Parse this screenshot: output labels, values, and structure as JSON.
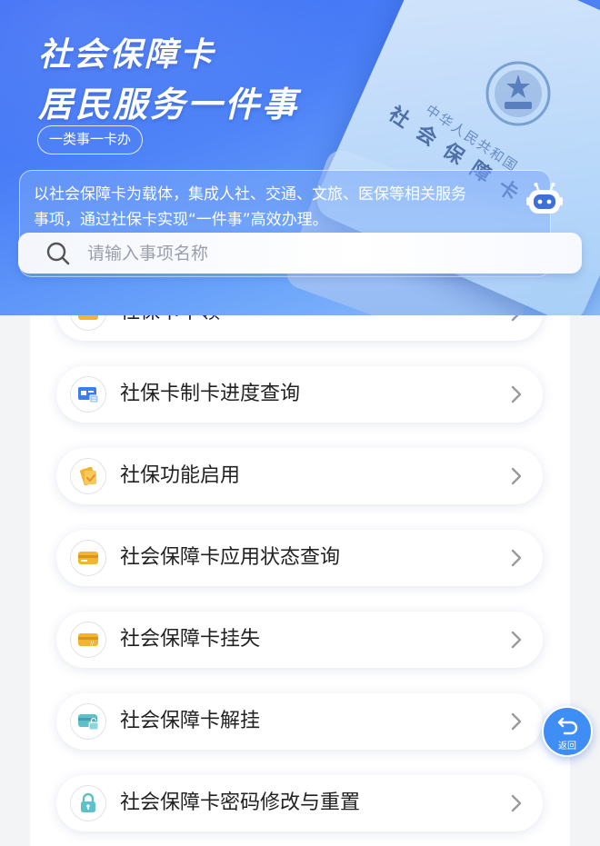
{
  "banner": {
    "title_line1": "社会保障卡",
    "title_line2": "居民服务一件事",
    "tag": "一类事一卡办",
    "description": "以社会保障卡为载体，集成人社、交通、文旅、医保等相关服务事项，通过社保卡实现“一件事”高效办理。",
    "card_country": "中华人民共和国",
    "card_title": "社会保障卡"
  },
  "search": {
    "placeholder": "请输入事项名称",
    "icon": "search-icon"
  },
  "services": [
    {
      "label": "社保卡申领",
      "icon": "card-apply-icon"
    },
    {
      "label": "社保卡制卡进度查询",
      "icon": "card-progress-icon"
    },
    {
      "label": "社保功能启用",
      "icon": "function-enable-icon"
    },
    {
      "label": "社会保障卡应用状态查询",
      "icon": "card-status-icon"
    },
    {
      "label": "社会保障卡挂失",
      "icon": "card-report-loss-icon"
    },
    {
      "label": "社会保障卡解挂",
      "icon": "card-unlock-icon"
    },
    {
      "label": "社会保障卡密码修改与重置",
      "icon": "password-lock-icon"
    }
  ],
  "back_button": {
    "label": "返回",
    "icon": "return-arrow-icon"
  },
  "colors": {
    "brand_blue": "#3f8ef5",
    "icon_yellow": "#f2b431",
    "icon_blue": "#3a7ff0",
    "icon_teal": "#5ec0c8"
  }
}
